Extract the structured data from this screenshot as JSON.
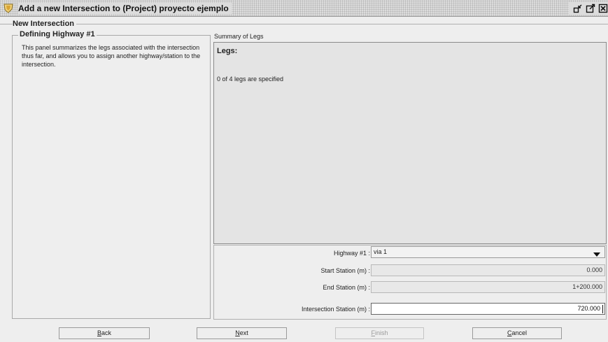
{
  "window": {
    "title": "Add a new Intersection to (Project) proyecto ejemplo",
    "icon": "shield-icon",
    "controls": [
      "minimize-icon",
      "maximize-icon",
      "close-icon"
    ]
  },
  "group": {
    "title": "New Intersection"
  },
  "left_panel": {
    "legend": "Defining Highway #1",
    "description": "This panel summarizes the legs associated with the intersection thus far, and allows you to assign another highway/station to the intersection."
  },
  "summary": {
    "label": "Summary of Legs",
    "legs_title": "Legs:",
    "legs_count_text": "0 of 4 legs are specified"
  },
  "form": {
    "highway_label": "Highway #1 :",
    "highway_value": "via 1",
    "start_label": "Start Station (m) :",
    "start_value": "0.000",
    "end_label": "End Station (m) :",
    "end_value": "1+200.000",
    "intersection_label": "Intersection Station (m) :",
    "intersection_value": "720.000"
  },
  "buttons": {
    "back": {
      "mnemonic": "B",
      "rest": "ack"
    },
    "next": {
      "mnemonic": "N",
      "rest": "ext"
    },
    "finish": {
      "mnemonic": "F",
      "rest": "inish"
    },
    "cancel": {
      "mnemonic": "C",
      "rest": "ancel"
    }
  }
}
